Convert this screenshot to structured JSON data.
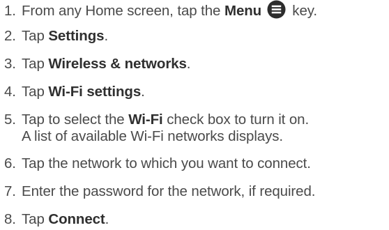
{
  "steps": [
    {
      "num": "1.",
      "pre": "From any Home screen, tap the ",
      "bold": "Menu",
      "post": " key.",
      "icon": "menu-icon"
    },
    {
      "num": "2.",
      "pre": "Tap ",
      "bold": "Settings",
      "post": "."
    },
    {
      "num": "3.",
      "pre": "Tap ",
      "bold": "Wireless & networks",
      "post": "."
    },
    {
      "num": "4.",
      "pre": "Tap ",
      "bold": "Wi-Fi settings",
      "post": "."
    },
    {
      "num": "5.",
      "pre": "Tap to select the ",
      "bold": "Wi-Fi",
      "post": " check box to turn it on.",
      "line2": "A list of available Wi-Fi networks displays."
    },
    {
      "num": "6.",
      "text": "Tap the network to which you want to connect."
    },
    {
      "num": "7.",
      "text": "Enter the password for the network, if required."
    },
    {
      "num": "8.",
      "pre": "Tap ",
      "bold": "Connect",
      "post": "."
    }
  ]
}
